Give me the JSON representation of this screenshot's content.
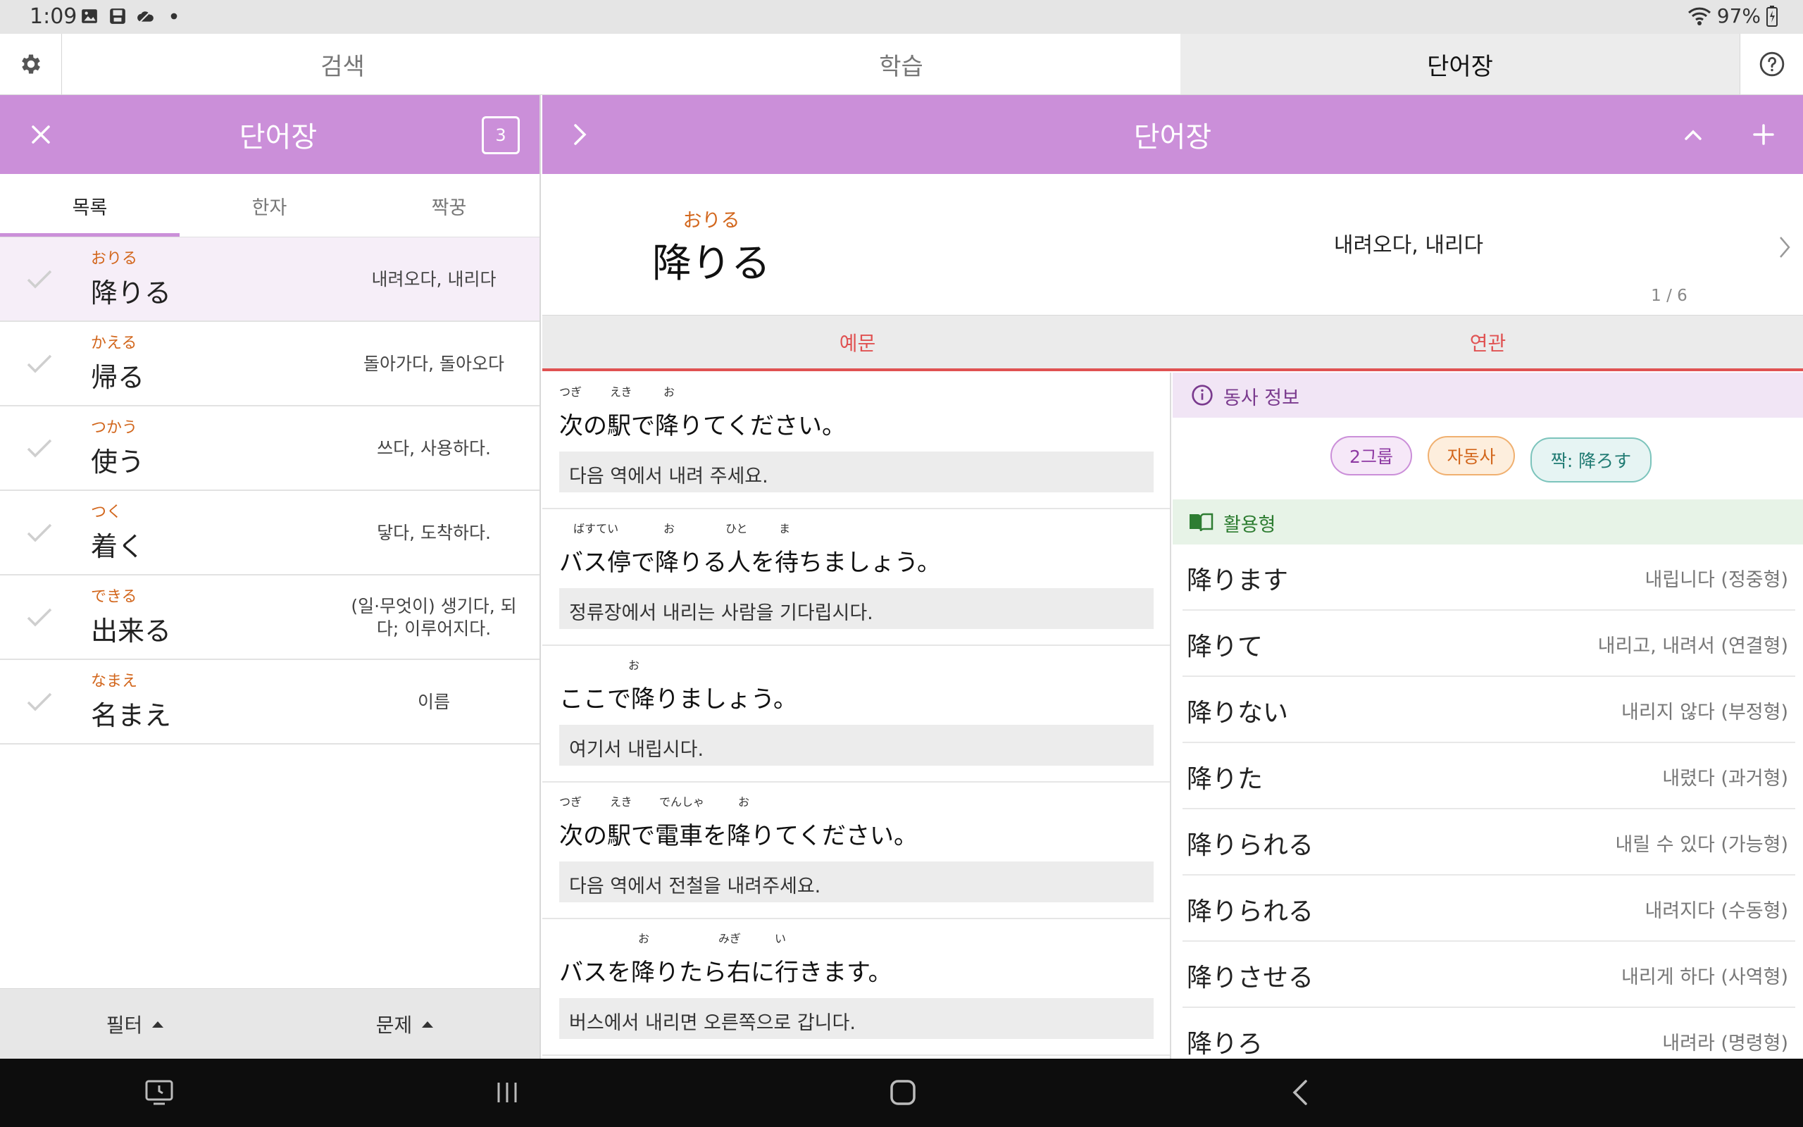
{
  "status": {
    "time": "1:09",
    "battery": "97%",
    "icons": [
      "image-icon",
      "save-icon",
      "cloud-icon",
      "dot-icon"
    ]
  },
  "top_tabs": [
    {
      "label": "검색"
    },
    {
      "label": "학습"
    },
    {
      "label": "단어장",
      "active": true
    }
  ],
  "left": {
    "title": "단어장",
    "count": "3",
    "subtabs": [
      "목록",
      "한자",
      "짝꿍"
    ],
    "words": [
      {
        "reading": "おりる",
        "word": "降りる",
        "meaning": "내려오다, 내리다",
        "selected": true
      },
      {
        "reading": "かえる",
        "word": "帰る",
        "meaning": "돌아가다, 돌아오다"
      },
      {
        "reading": "つかう",
        "word": "使う",
        "meaning": "쓰다, 사용하다."
      },
      {
        "reading": "つく",
        "word": "着く",
        "meaning": "닿다, 도착하다."
      },
      {
        "reading": "できる",
        "word": "出来る",
        "meaning": "(일·무엇이) 생기다, 되다; 이루어지다."
      },
      {
        "reading": "なまえ",
        "word": "名まえ",
        "meaning": "이름"
      }
    ],
    "filter_label": "필터",
    "quiz_label": "문제"
  },
  "right": {
    "title": "단어장",
    "entry": {
      "reading": "おりる",
      "word": "降りる",
      "meaning": "내려오다, 내리다",
      "page": "1 / 6"
    },
    "tabs": [
      "예문",
      "연관"
    ],
    "examples": [
      {
        "jp": "次の駅で降りてください。",
        "furigana": [
          "つぎ",
          "えき",
          "お"
        ],
        "ko": "다음 역에서 내려 주세요."
      },
      {
        "jp": "バス停で降りる人を待ちましょう。",
        "furigana": [
          "ばすてい",
          "お",
          "ひと",
          "ま"
        ],
        "ko": "정류장에서 내리는 사람을 기다립시다."
      },
      {
        "jp": "ここで降りましょう。",
        "furigana": [
          "お"
        ],
        "ko": "여기서 내립시다."
      },
      {
        "jp": "次の駅で電車を降りてください。",
        "furigana": [
          "つぎ",
          "えき",
          "でんしゃ",
          "お"
        ],
        "ko": "다음 역에서 전철을 내려주세요."
      },
      {
        "jp": "バスを降りたら右に行きます。",
        "furigana": [
          "お",
          "みぎ",
          "い"
        ],
        "ko": "버스에서 내리면 오른쪽으로 갑니다."
      }
    ],
    "verb_info": {
      "title": "동사 정보",
      "tags": [
        "2그룹",
        "자동사",
        "짝: 降ろす"
      ],
      "conj_title": "활용형",
      "conjugations": [
        {
          "jp": "降ります",
          "ko": "내립니다 (정중형)"
        },
        {
          "jp": "降りて",
          "ko": "내리고, 내려서 (연결형)"
        },
        {
          "jp": "降りない",
          "ko": "내리지 않다 (부정형)"
        },
        {
          "jp": "降りた",
          "ko": "내렸다 (과거형)"
        },
        {
          "jp": "降りられる",
          "ko": "내릴 수 있다 (가능형)"
        },
        {
          "jp": "降りられる",
          "ko": "내려지다 (수동형)"
        },
        {
          "jp": "降りさせる",
          "ko": "내리게 하다 (사역형)"
        },
        {
          "jp": "降りろ",
          "ko": "내려라 (명령형)"
        }
      ]
    }
  },
  "colors": {
    "accent_purple": "#cb8fd9",
    "reading_orange": "#d2661c",
    "tab_red": "#e05252"
  }
}
